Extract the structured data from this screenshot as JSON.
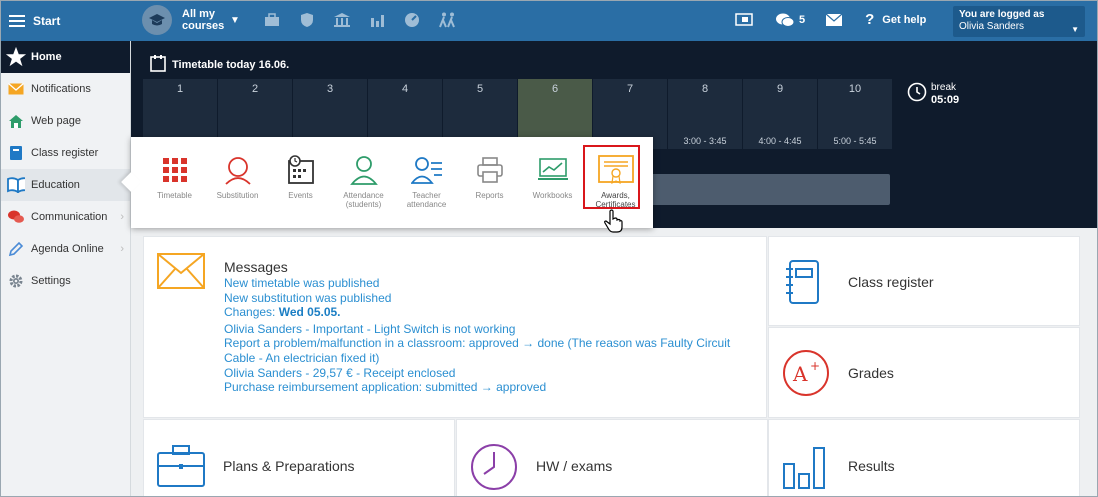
{
  "topbar": {
    "start_label": "Start",
    "courses_label": "All my courses",
    "notifications_count": "5",
    "help_label": "Get help",
    "login_line1": "You are logged as",
    "login_user": "Olivia Sanders"
  },
  "sidebar": {
    "home": "Home",
    "items": [
      {
        "label": "Notifications",
        "icon": "envelope-icon"
      },
      {
        "label": "Web page",
        "icon": "house-icon"
      },
      {
        "label": "Class register",
        "icon": "book-icon"
      },
      {
        "label": "Education",
        "icon": "open-book-icon"
      },
      {
        "label": "Communication",
        "icon": "chat-icon"
      },
      {
        "label": "Agenda Online",
        "icon": "pencil-icon"
      },
      {
        "label": "Settings",
        "icon": "gear-icon"
      }
    ]
  },
  "timetable": {
    "title": "Timetable today 16.06.",
    "periods": [
      {
        "n": "1",
        "t": ""
      },
      {
        "n": "2",
        "t": ""
      },
      {
        "n": "3",
        "t": ""
      },
      {
        "n": "4",
        "t": ""
      },
      {
        "n": "5",
        "t": ""
      },
      {
        "n": "6",
        "t": ""
      },
      {
        "n": "7",
        "t": ""
      },
      {
        "n": "8",
        "t": "3:00 - 3:45"
      },
      {
        "n": "9",
        "t": "4:00 - 4:45"
      },
      {
        "n": "10",
        "t": "5:00 - 5:45"
      }
    ],
    "break_label": "break",
    "break_time": "05:09"
  },
  "education_menu": {
    "timetable": "Timetable",
    "substitution": "Substitution",
    "events": "Events",
    "attendance_students": "Attendance (students)",
    "teacher_attendance": "Teacher attendance",
    "reports": "Reports",
    "workbooks": "Workbooks",
    "awards": "Awards, Certificates"
  },
  "messages": {
    "title": "Messages",
    "line1": "New timetable was published",
    "line2": "New substitution was published",
    "changes_prefix": "Changes: ",
    "changes_date": "Wed 05.05.",
    "line4": "Olivia Sanders - Important - Light Switch is not working",
    "line5": "Report a problem/malfunction in a classroom: approved → done (The reason was Faulty Circuit Cable - An electrician fixed it)",
    "line6": "Olivia Sanders - 29,57 € - Receipt enclosed",
    "line7": "Purchase reimbursement application: submitted → approved"
  },
  "tiles": {
    "class_register": "Class register",
    "grades": "Grades",
    "plans": "Plans & Preparations",
    "hw": "HW / exams",
    "results": "Results"
  },
  "colors": {
    "topbar": "#2a6ea5",
    "dark_bg": "#0f1b2c",
    "highlight": "#d9161b",
    "link": "#2b8fd1"
  }
}
